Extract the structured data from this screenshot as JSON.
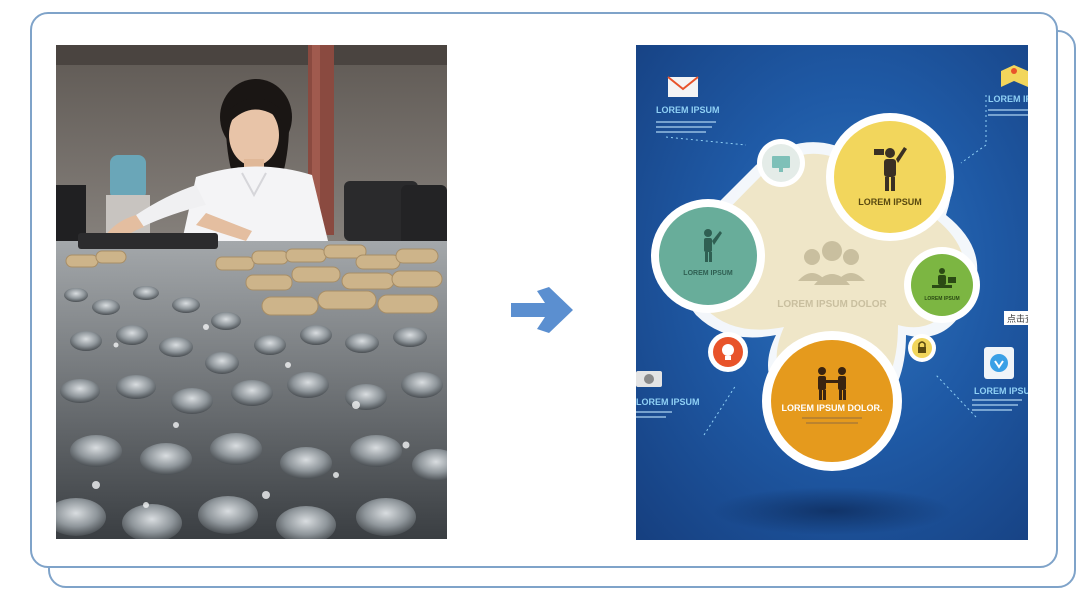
{
  "arrow": {
    "color": "#5b8fd0"
  },
  "infographic": {
    "colors": {
      "background": "#1f5aa6",
      "yellow": "#f2d65c",
      "teal": "#68ad9a",
      "green": "#7cb642",
      "orange": "#e59a1d",
      "red": "#e8532a",
      "center": "#efe6c8",
      "accent_text": "#8fd0f5"
    },
    "labels": {
      "top_left": "LOREM IPSUM",
      "top_right": "LOREM IPSU",
      "mid_left": "LOREM IPSUM",
      "bottom_right": "LOREM IPSUM",
      "yellow_circle": "LOREM IPSUM",
      "teal_circle": "LOREM IPSUM",
      "green_circle": "LOREM IPSUM",
      "center": "LOREM IPSUM DOLOR",
      "orange_circle": "LOREM IPSUM DOLOR.",
      "side_tag": "点击查"
    }
  }
}
